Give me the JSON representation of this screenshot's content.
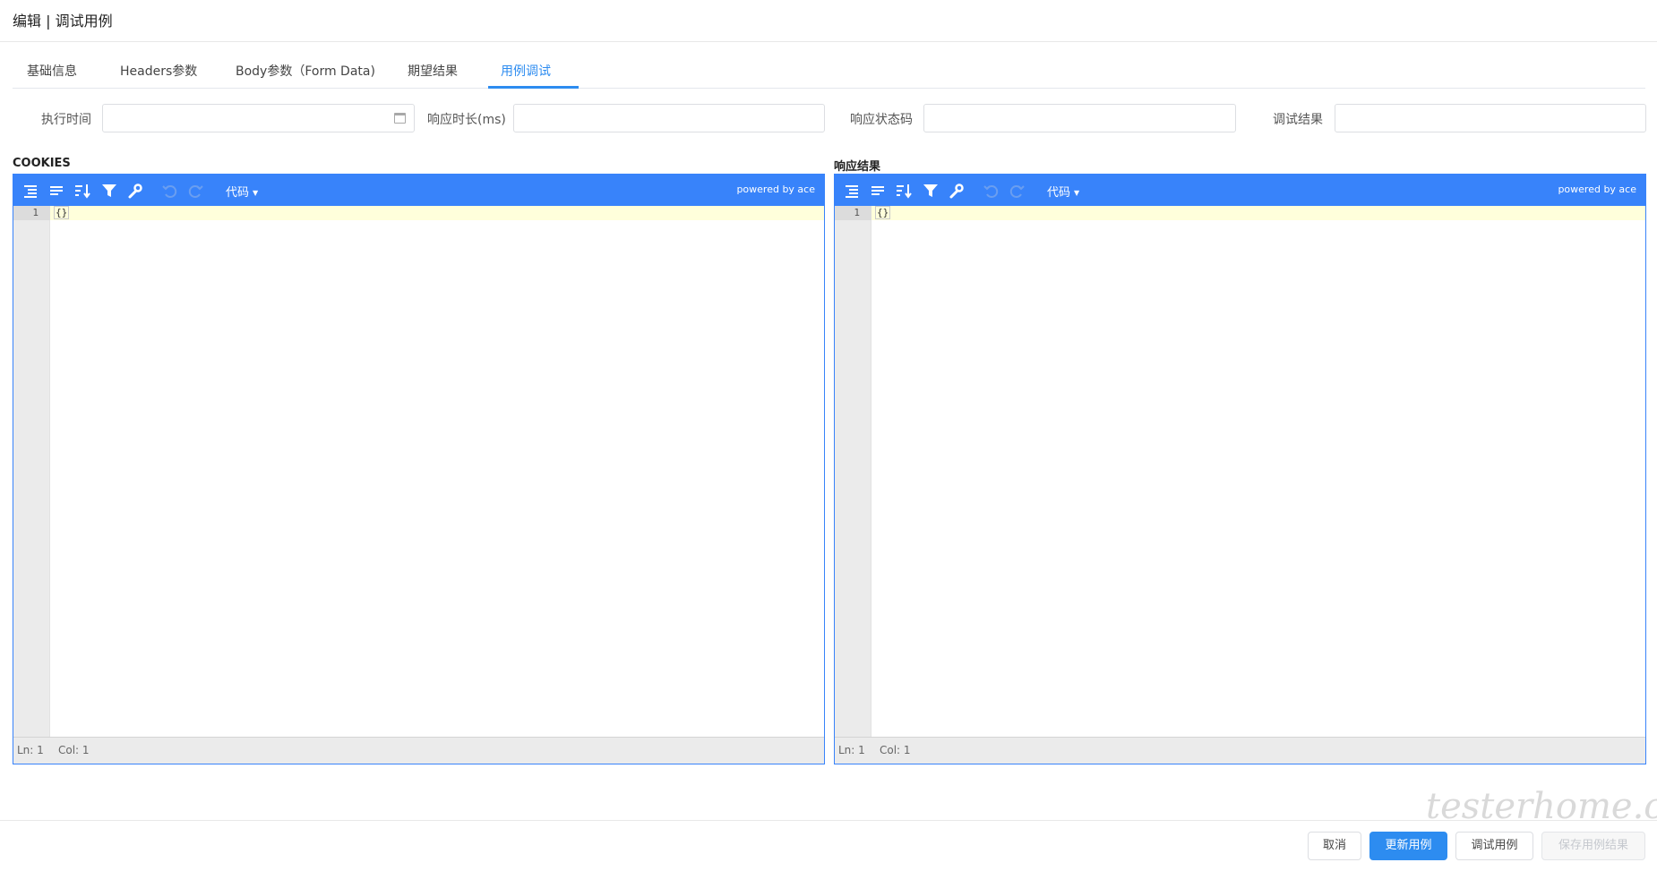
{
  "dialog": {
    "title": "编辑 | 调试用例"
  },
  "tabs": [
    {
      "label": "基础信息"
    },
    {
      "label": "Headers参数"
    },
    {
      "label": "Body参数（Form Data)"
    },
    {
      "label": "期望结果"
    },
    {
      "label": "用例调试",
      "active": true
    }
  ],
  "fields": {
    "exec_time": {
      "label": "执行时间",
      "value": ""
    },
    "duration": {
      "label": "响应时长(ms)",
      "value": ""
    },
    "status_code": {
      "label": "响应状态码",
      "value": ""
    },
    "debug_result": {
      "label": "调试结果",
      "value": ""
    }
  },
  "cookies_editor": {
    "title": "COOKIES",
    "mode": "代码",
    "powered_by": "powered by ace",
    "line_number": "1",
    "content": "{}",
    "status_ln": "Ln: 1",
    "status_col": "Col: 1"
  },
  "response_editor": {
    "title": "响应结果",
    "mode": "代码",
    "powered_by": "powered by ace",
    "line_number": "1",
    "content": "{}",
    "status_ln": "Ln: 1",
    "status_col": "Col: 1"
  },
  "footer": {
    "cancel": "取消",
    "update_case": "更新用例",
    "debug_case": "调试用例",
    "save_result": "保存用例结果"
  },
  "watermark": "testerhome.com",
  "colors": {
    "accent": "#2d8cf0",
    "editor_toolbar": "#3883fa",
    "active_line": "#ffffdb"
  }
}
